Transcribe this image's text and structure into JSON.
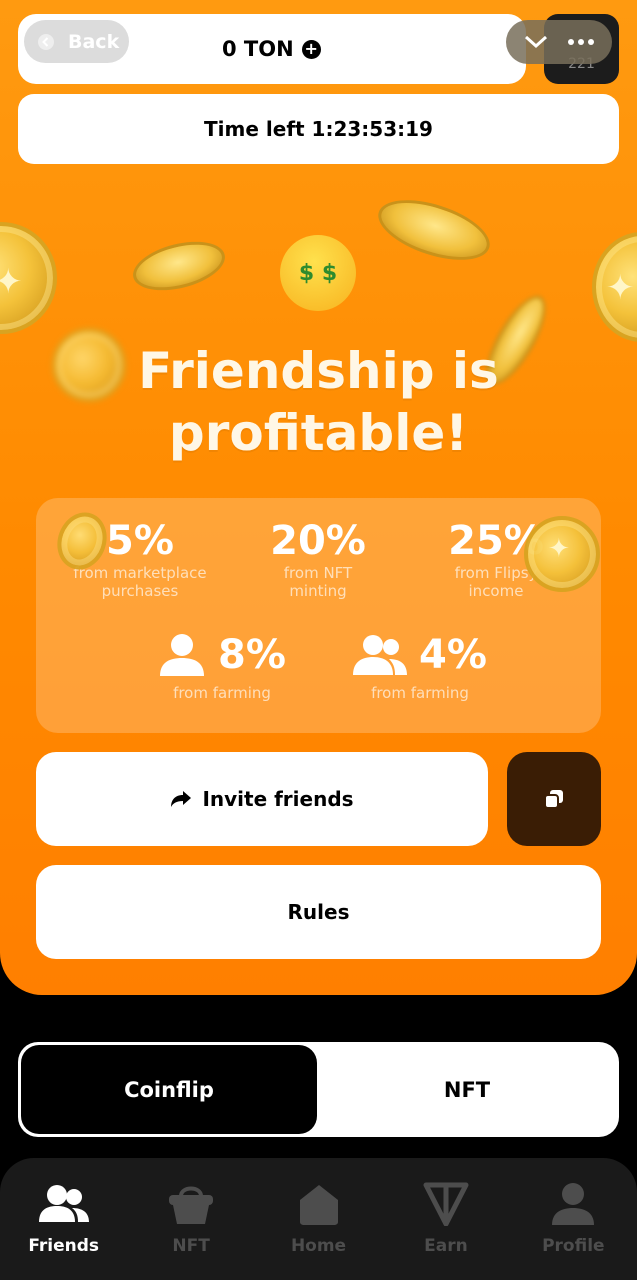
{
  "header": {
    "back_label": "Back",
    "balance": "0 TON",
    "corner_badge": "221"
  },
  "timer": {
    "text": "Time left 1:23:53:19"
  },
  "headline": {
    "line1": "Friendship is",
    "line2": "profitable!"
  },
  "stats": {
    "items": [
      {
        "value": "5%",
        "caption1": "from marketplace",
        "caption2": "purchases"
      },
      {
        "value": "20%",
        "caption1": "from NFT",
        "caption2": "minting"
      },
      {
        "value": "25%",
        "caption1": "from Flipsy",
        "caption2": "income"
      }
    ],
    "farming": [
      {
        "value": "8%",
        "caption": "from farming",
        "icon": "user-icon"
      },
      {
        "value": "4%",
        "caption": "from farming",
        "icon": "users-icon"
      }
    ]
  },
  "actions": {
    "invite_label": "Invite friends",
    "rules_label": "Rules"
  },
  "segmented": {
    "active": "Coinflip",
    "inactive": "NFT"
  },
  "nav": {
    "items": [
      {
        "label": "Friends",
        "icon": "users-icon",
        "active": true
      },
      {
        "label": "NFT",
        "icon": "basket-icon",
        "active": false
      },
      {
        "label": "Home",
        "icon": "home-icon",
        "active": false
      },
      {
        "label": "Earn",
        "icon": "ton-icon",
        "active": false
      },
      {
        "label": "Profile",
        "icon": "user-icon",
        "active": false
      }
    ]
  },
  "colors": {
    "accent_orange": "#ff8a00",
    "dark_brown": "#3a1d05",
    "nav_bg": "#1a1a1a"
  }
}
